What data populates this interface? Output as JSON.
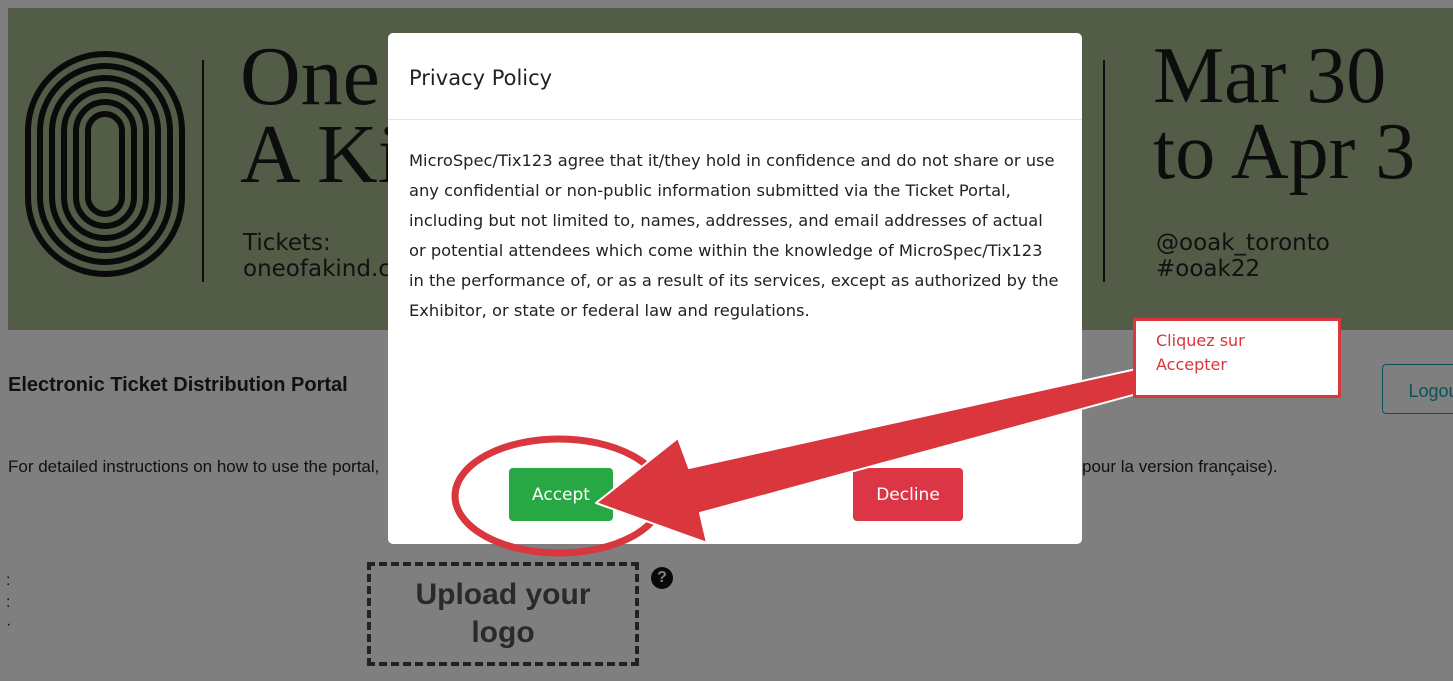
{
  "banner": {
    "title_line1": "One of",
    "title_line2": "A Kind",
    "tickets_label": "Tickets:",
    "tickets_site": "oneofakind.com",
    "dates_line1": "Mar 30",
    "dates_line2": "to Apr 3",
    "handle": "@ooak_toronto",
    "hashtag": "#ooak22",
    "background_color": "#a5b98d"
  },
  "page": {
    "portal_title": "Electronic Ticket Distribution Portal",
    "logout_label": "Logout",
    "instructions_left": "For detailed instructions on how to use the portal,",
    "instructions_right": "pour la version française).",
    "upload_logo_label": "Upload your logo",
    "help_icon": "question-circle-icon"
  },
  "modal": {
    "title": "Privacy Policy",
    "body": "MicroSpec/Tix123 agree that it/they hold in confidence and do not share or use any confidential or non-public information submitted via the Ticket Portal, including but not limited to, names, addresses, and email addresses of actual or potential attendees which come within the knowledge of MicroSpec/Tix123 in the performance of, or as a result of its services, except as authorized by the Exhibitor, or state or federal law and regulations.",
    "accept_label": "Accept",
    "decline_label": "Decline",
    "accept_color": "#28a745",
    "decline_color": "#dc3545"
  },
  "annotation": {
    "callout_text": "Cliquez sur Accepter",
    "color": "#d9363e"
  }
}
